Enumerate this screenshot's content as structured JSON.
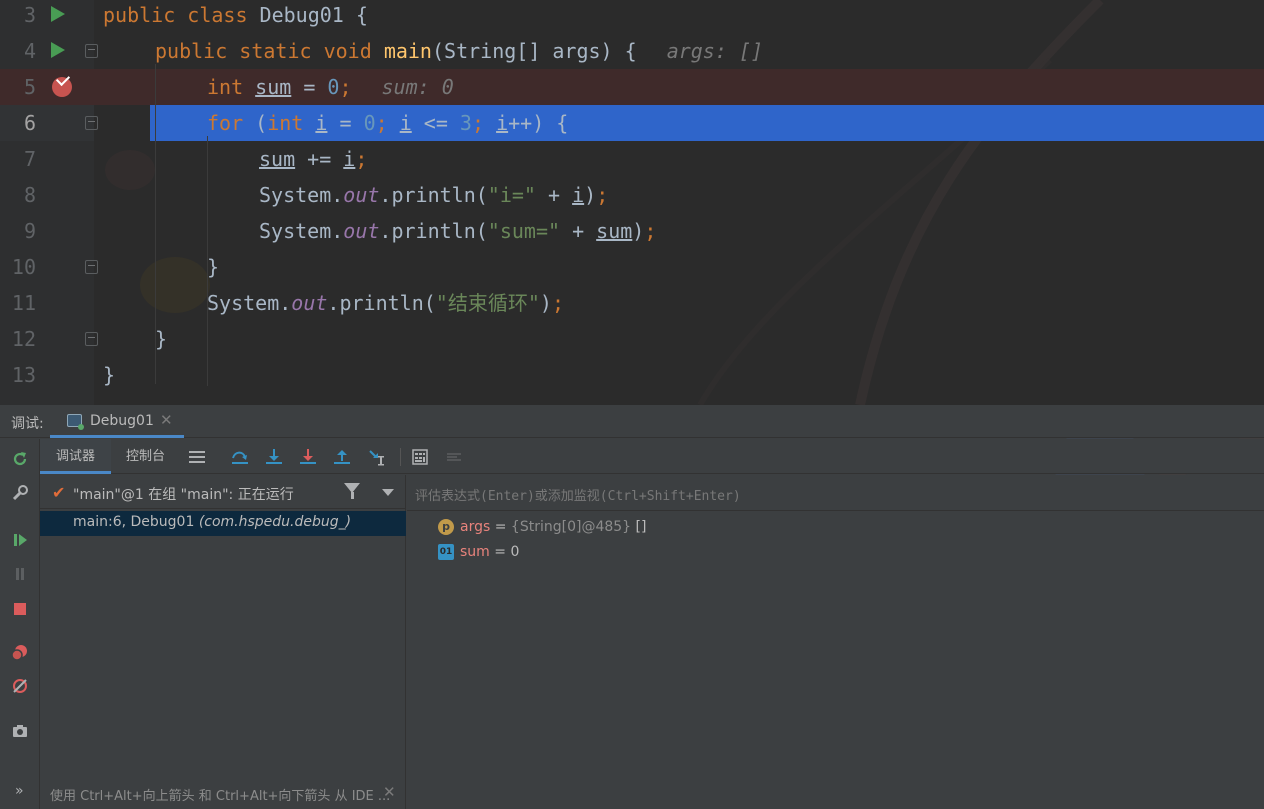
{
  "editor": {
    "lines": [
      {
        "no": "3",
        "parts": [
          [
            "kw",
            "public"
          ],
          [
            "t",
            " "
          ],
          [
            "kw",
            "class"
          ],
          [
            "t",
            " Debug01 {"
          ]
        ],
        "gutter": "run",
        "indent": 0
      },
      {
        "no": "4",
        "parts": [
          [
            "kw",
            "public"
          ],
          [
            "t",
            " "
          ],
          [
            "kw",
            "static"
          ],
          [
            "t",
            " "
          ],
          [
            "kw",
            "void"
          ],
          [
            "t",
            " "
          ],
          [
            "fn",
            "main"
          ],
          [
            "t",
            "(String[] args) {"
          ]
        ],
        "inlay": "args: []",
        "gutter": "run",
        "fold": true,
        "indent": 1
      },
      {
        "no": "5",
        "parts": [
          [
            "kw",
            "int"
          ],
          [
            "t",
            " "
          ],
          [
            "var",
            "sum"
          ],
          [
            "t",
            " = "
          ],
          [
            "num",
            "0"
          ],
          [
            "kw",
            ";"
          ]
        ],
        "inlay": "sum: 0",
        "gutter": "breakpoint",
        "indent": 2,
        "state": "breakpoint"
      },
      {
        "no": "6",
        "parts": [
          [
            "kw",
            "for"
          ],
          [
            "t",
            " ("
          ],
          [
            "kw",
            "int"
          ],
          [
            "t",
            " "
          ],
          [
            "var",
            "i"
          ],
          [
            "t",
            " = "
          ],
          [
            "num",
            "0"
          ],
          [
            "kw",
            ";"
          ],
          [
            "t",
            " "
          ],
          [
            "var",
            "i"
          ],
          [
            "t",
            " <= "
          ],
          [
            "num",
            "3"
          ],
          [
            "kw",
            ";"
          ],
          [
            "t",
            " "
          ],
          [
            "var",
            "i"
          ],
          [
            "t",
            "++) {"
          ]
        ],
        "fold": true,
        "indent": 2,
        "state": "current"
      },
      {
        "no": "7",
        "parts": [
          [
            "var",
            "sum"
          ],
          [
            "t",
            " += "
          ],
          [
            "var",
            "i"
          ],
          [
            "kw",
            ";"
          ]
        ],
        "indent": 3
      },
      {
        "no": "8",
        "parts": [
          [
            "t",
            "System."
          ],
          [
            "fld",
            "out"
          ],
          [
            "t",
            ".println("
          ],
          [
            "str",
            "\"i=\""
          ],
          [
            "t",
            " + "
          ],
          [
            "var",
            "i"
          ],
          [
            "t",
            ")"
          ],
          [
            "kw",
            ";"
          ]
        ],
        "indent": 3
      },
      {
        "no": "9",
        "parts": [
          [
            "t",
            "System."
          ],
          [
            "fld",
            "out"
          ],
          [
            "t",
            ".println("
          ],
          [
            "str",
            "\"sum=\""
          ],
          [
            "t",
            " + "
          ],
          [
            "var",
            "sum"
          ],
          [
            "t",
            ")"
          ],
          [
            "kw",
            ";"
          ]
        ],
        "indent": 3
      },
      {
        "no": "10",
        "parts": [
          [
            "t",
            "}"
          ]
        ],
        "fold": true,
        "indent": 2
      },
      {
        "no": "11",
        "parts": [
          [
            "t",
            "System."
          ],
          [
            "fld",
            "out"
          ],
          [
            "t",
            ".println("
          ],
          [
            "str",
            "\"结束循环\""
          ],
          [
            "t",
            ")"
          ],
          [
            "kw",
            ";"
          ]
        ],
        "indent": 2
      },
      {
        "no": "12",
        "parts": [
          [
            "t",
            "}"
          ]
        ],
        "fold": true,
        "indent": 1
      },
      {
        "no": "13",
        "parts": [
          [
            "t",
            "}"
          ]
        ],
        "indent": 0
      }
    ]
  },
  "debug": {
    "label": "调试:",
    "session_tab": "Debug01",
    "tabs": [
      "调试器",
      "控制台"
    ],
    "thread": "\"main\"@1 在组 \"main\": 正在运行",
    "frame": {
      "location": "main:6, Debug01",
      "package": "(com.hspedu.debug_)"
    },
    "hint": "使用 Ctrl+Alt+向上箭头 和 Ctrl+Alt+向下箭头 从 IDE ...",
    "watch_placeholder": "评估表达式(Enter)或添加监视(Ctrl+Shift+Enter)",
    "variables": [
      {
        "icon": "p",
        "name": "args",
        "eq": " = ",
        "type": "{String[0]@485}",
        "value": " []"
      },
      {
        "icon": "01",
        "name": "sum",
        "eq": " = ",
        "type": "",
        "value": "0"
      }
    ]
  },
  "colors": {
    "editor_bg": "#2b2b2b",
    "current_line": "#2f65ca",
    "breakpoint_line": "#3f2a2a",
    "keyword": "#cc7832",
    "number": "#6897bb",
    "string": "#6a8759",
    "field": "#9876aa",
    "method": "#ffc66d",
    "panel_bg": "#3c3f41",
    "selected_frame": "#0d293e"
  },
  "icons": {
    "left_toolbar": [
      "rerun-icon",
      "settings-wrench-icon",
      "resume-icon",
      "pause-icon",
      "stop-icon",
      "view-breakpoints-icon",
      "mute-breakpoints-icon",
      "camera-icon"
    ],
    "top_toolbar": [
      "layout-menu-icon",
      "step-over-icon",
      "step-into-icon",
      "force-step-into-icon",
      "step-out-icon",
      "run-to-cursor-icon",
      "evaluate-expression-icon",
      "trace-stream-icon"
    ]
  }
}
